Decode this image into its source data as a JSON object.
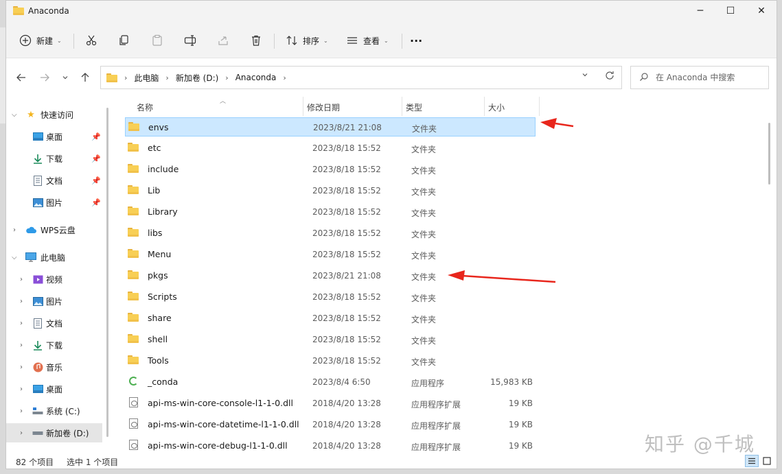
{
  "window": {
    "title": "Anaconda"
  },
  "titlebar": {
    "minimize": "─",
    "maximize": "☐",
    "close": "✕"
  },
  "toolbar": {
    "new_label": "新建",
    "sort_label": "排序",
    "view_label": "查看",
    "more_label": "···"
  },
  "address": {
    "crumbs": [
      "此电脑",
      "新加卷 (D:)",
      "Anaconda"
    ]
  },
  "search": {
    "placeholder": "在 Anaconda 中搜索"
  },
  "nav": {
    "quick_access": "快速访问",
    "qa_items": [
      "桌面",
      "下载",
      "文档",
      "图片"
    ],
    "wps": "WPS云盘",
    "this_pc": "此电脑",
    "pc_items": [
      "视频",
      "图片",
      "文档",
      "下载",
      "音乐",
      "桌面",
      "系统 (C:)",
      "新加卷 (D:)"
    ]
  },
  "columns": {
    "name": "名称",
    "date": "修改日期",
    "type": "类型",
    "size": "大小"
  },
  "files": [
    {
      "name": "envs",
      "date": "2023/8/21 21:08",
      "type": "文件夹",
      "size": "",
      "kind": "folder",
      "selected": true
    },
    {
      "name": "etc",
      "date": "2023/8/18 15:52",
      "type": "文件夹",
      "size": "",
      "kind": "folder"
    },
    {
      "name": "include",
      "date": "2023/8/18 15:52",
      "type": "文件夹",
      "size": "",
      "kind": "folder"
    },
    {
      "name": "Lib",
      "date": "2023/8/18 15:52",
      "type": "文件夹",
      "size": "",
      "kind": "folder"
    },
    {
      "name": "Library",
      "date": "2023/8/18 15:52",
      "type": "文件夹",
      "size": "",
      "kind": "folder"
    },
    {
      "name": "libs",
      "date": "2023/8/18 15:52",
      "type": "文件夹",
      "size": "",
      "kind": "folder"
    },
    {
      "name": "Menu",
      "date": "2023/8/18 15:52",
      "type": "文件夹",
      "size": "",
      "kind": "folder"
    },
    {
      "name": "pkgs",
      "date": "2023/8/21 21:08",
      "type": "文件夹",
      "size": "",
      "kind": "folder"
    },
    {
      "name": "Scripts",
      "date": "2023/8/18 15:52",
      "type": "文件夹",
      "size": "",
      "kind": "folder"
    },
    {
      "name": "share",
      "date": "2023/8/18 15:52",
      "type": "文件夹",
      "size": "",
      "kind": "folder"
    },
    {
      "name": "shell",
      "date": "2023/8/18 15:52",
      "type": "文件夹",
      "size": "",
      "kind": "folder"
    },
    {
      "name": "Tools",
      "date": "2023/8/18 15:52",
      "type": "文件夹",
      "size": "",
      "kind": "folder"
    },
    {
      "name": "_conda",
      "date": "2023/8/4 6:50",
      "type": "应用程序",
      "size": "15,983 KB",
      "kind": "app"
    },
    {
      "name": "api-ms-win-core-console-l1-1-0.dll",
      "date": "2018/4/20 13:28",
      "type": "应用程序扩展",
      "size": "19 KB",
      "kind": "dll"
    },
    {
      "name": "api-ms-win-core-datetime-l1-1-0.dll",
      "date": "2018/4/20 13:28",
      "type": "应用程序扩展",
      "size": "19 KB",
      "kind": "dll"
    },
    {
      "name": "api-ms-win-core-debug-l1-1-0.dll",
      "date": "2018/4/20 13:28",
      "type": "应用程序扩展",
      "size": "19 KB",
      "kind": "dll"
    }
  ],
  "status": {
    "count": "82 个项目",
    "selection": "选中 1 个项目"
  },
  "watermark": "知乎 @千城",
  "colors": {
    "selection_bg": "#cce8ff",
    "selection_border": "#99d1ff",
    "arrow": "#e8261c",
    "folder": "#f8cf55"
  }
}
